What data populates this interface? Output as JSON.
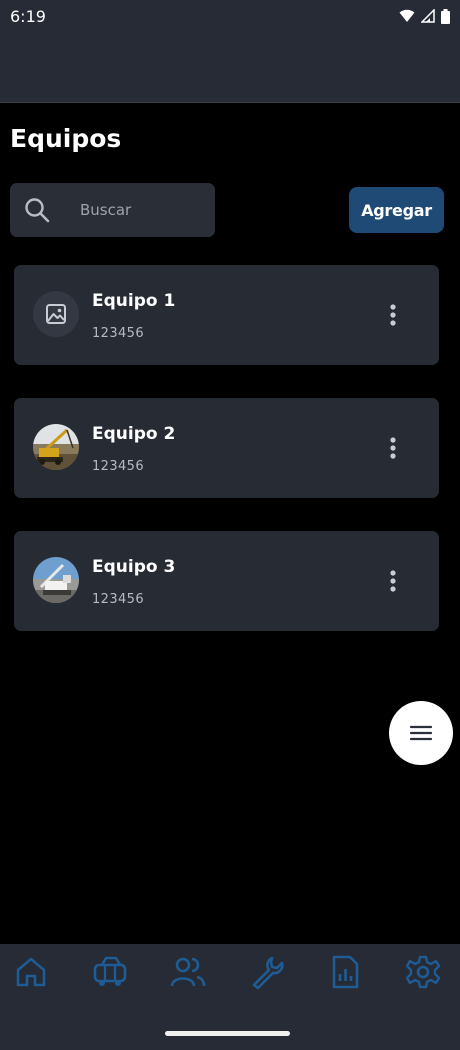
{
  "status_bar": {
    "time": "6:19"
  },
  "page": {
    "title": "Equipos"
  },
  "search": {
    "placeholder": "Buscar"
  },
  "toolbar": {
    "add_label": "Agregar"
  },
  "equipment": [
    {
      "name": "Equipo 1",
      "code": "123456",
      "avatar": "image-placeholder-icon"
    },
    {
      "name": "Equipo 2",
      "code": "123456",
      "avatar": "crane-photo"
    },
    {
      "name": "Equipo 3",
      "code": "123456",
      "avatar": "crane-photo"
    }
  ],
  "bottom_nav": [
    {
      "icon": "home-icon"
    },
    {
      "icon": "truck-icon"
    },
    {
      "icon": "users-icon"
    },
    {
      "icon": "wrench-icon"
    },
    {
      "icon": "report-icon"
    },
    {
      "icon": "gear-icon"
    }
  ],
  "colors": {
    "background": "#000000",
    "surface": "#272b34",
    "accent": "#1e4a75",
    "nav_icon": "#1f5b94"
  }
}
